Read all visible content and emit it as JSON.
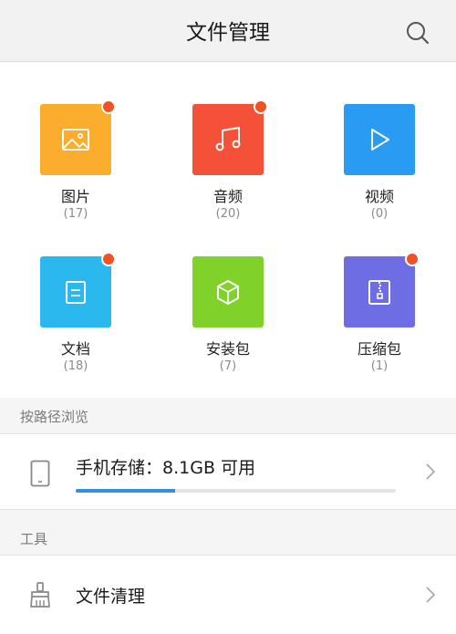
{
  "header": {
    "title": "文件管理",
    "search_icon": "search-icon"
  },
  "categories": [
    {
      "name": "图片",
      "count": "(17)",
      "color": "#fbae2d",
      "icon": "image-icon",
      "badge": true
    },
    {
      "name": "音频",
      "count": "(20)",
      "color": "#f55138",
      "icon": "music-icon",
      "badge": true
    },
    {
      "name": "视频",
      "count": "(0)",
      "color": "#2a9bf3",
      "icon": "play-icon",
      "badge": false
    },
    {
      "name": "文档",
      "count": "(18)",
      "color": "#2bb8ee",
      "icon": "document-icon",
      "badge": true
    },
    {
      "name": "安装包",
      "count": "(7)",
      "color": "#80d12a",
      "icon": "package-icon",
      "badge": false
    },
    {
      "name": "压缩包",
      "count": "(1)",
      "color": "#6e6de4",
      "icon": "archive-icon",
      "badge": true
    }
  ],
  "browse_section": {
    "label": "按路径浏览",
    "storage": {
      "text": "手机存储：8.1GB 可用",
      "icon": "phone-storage-icon",
      "used_fraction": 0.31
    }
  },
  "tools_section": {
    "label": "工具",
    "items": [
      {
        "label": "文件清理",
        "icon": "broom-icon"
      }
    ]
  },
  "colors": {
    "badge": "#ef5323",
    "progress": "#2f8fe6"
  }
}
